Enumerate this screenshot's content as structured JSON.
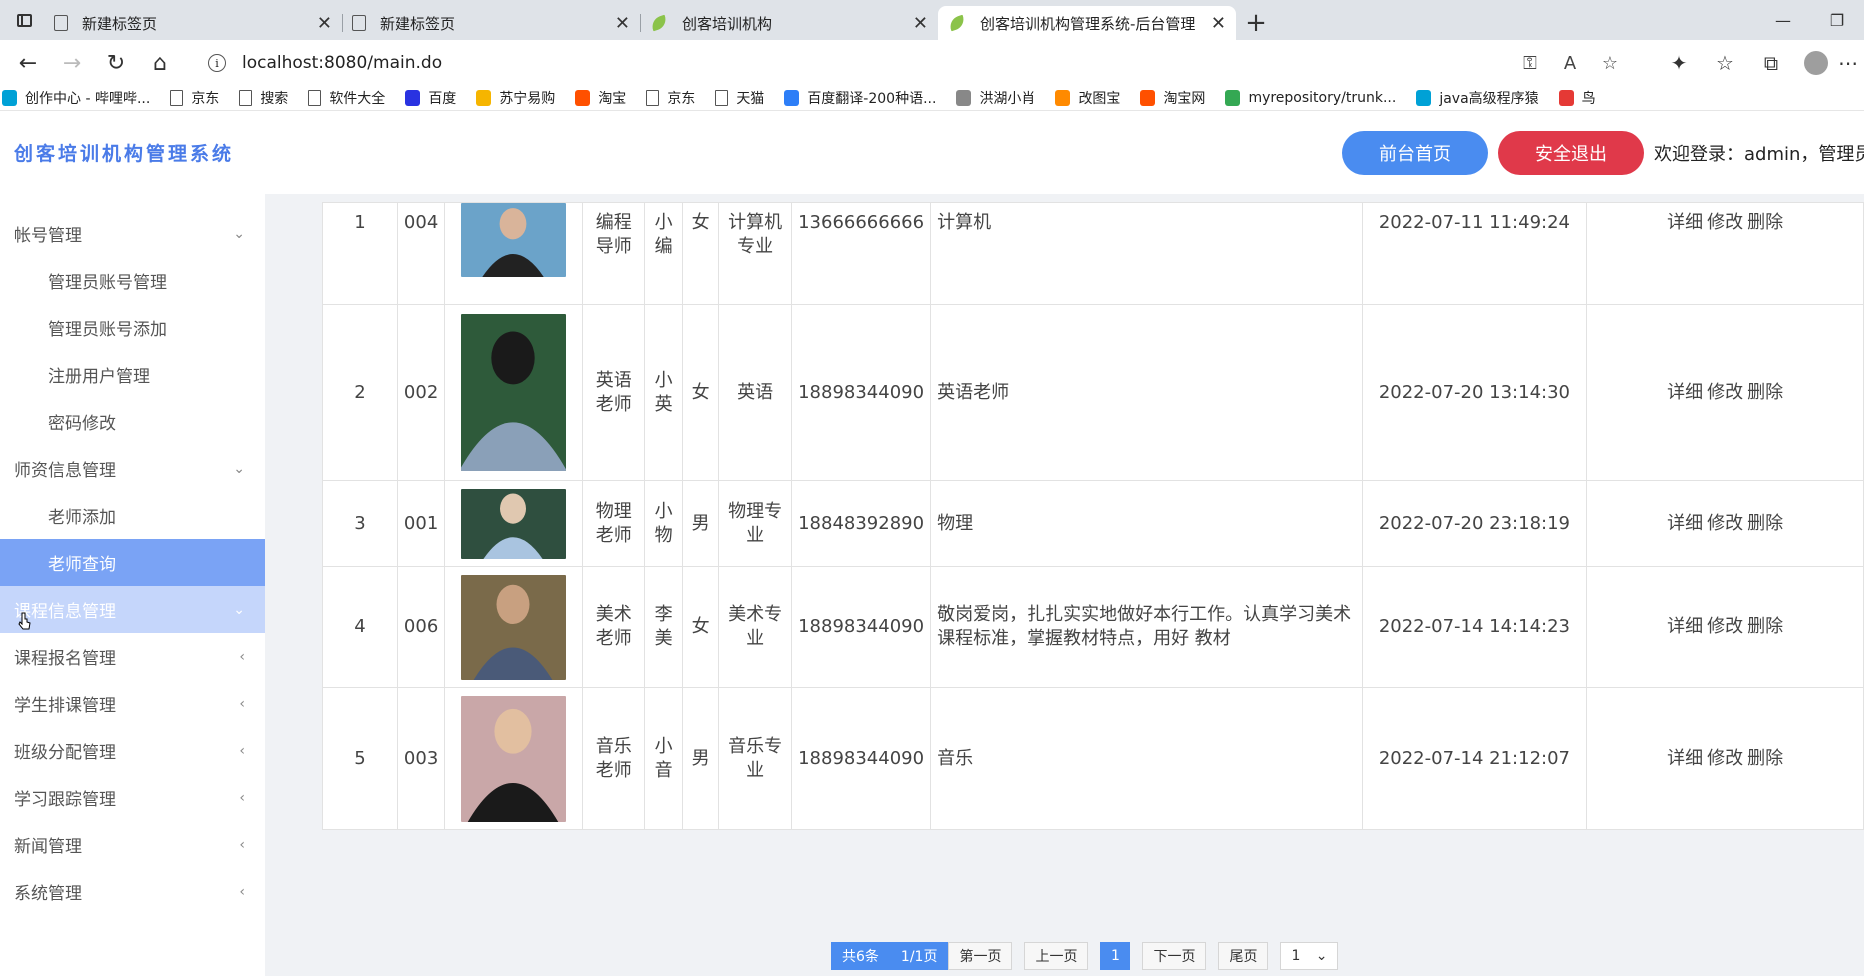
{
  "browser": {
    "tabs": [
      {
        "label": "新建标签页",
        "icon": "page",
        "active": false
      },
      {
        "label": "新建标签页",
        "icon": "page",
        "active": false
      },
      {
        "label": "创客培训机构",
        "icon": "leaf",
        "active": false
      },
      {
        "label": "创客培训机构管理系统-后台管理",
        "icon": "leaf",
        "active": true
      }
    ],
    "url": "localhost:8080/main.do",
    "bookmarks": [
      {
        "label": "创作中心 - 哔哩哔...",
        "color": "#00a1d6"
      },
      {
        "label": "京东",
        "color": "page"
      },
      {
        "label": "搜索",
        "color": "page"
      },
      {
        "label": "软件大全",
        "color": "page"
      },
      {
        "label": "百度",
        "color": "#2932e1"
      },
      {
        "label": "苏宁易购",
        "color": "#f6b500"
      },
      {
        "label": "淘宝",
        "color": "#ff5000"
      },
      {
        "label": "京东",
        "color": "page"
      },
      {
        "label": "天猫",
        "color": "page"
      },
      {
        "label": "百度翻译-200种语...",
        "color": "#2d7ef7"
      },
      {
        "label": "洪湖小肖",
        "color": "#888888"
      },
      {
        "label": "改图宝",
        "color": "#ff8a00"
      },
      {
        "label": "淘宝网",
        "color": "#ff5000"
      },
      {
        "label": "myrepository/trunk...",
        "color": "#34a853"
      },
      {
        "label": "java高级程序猿",
        "color": "#00a1d6"
      },
      {
        "label": "鸟",
        "color": "#e53935"
      }
    ]
  },
  "header": {
    "title": "创客培训机构管理系统",
    "home_btn": "前台首页",
    "logout_btn": "安全退出",
    "welcome": "欢迎登录：admin，管理员"
  },
  "sidebar": {
    "items": [
      {
        "label": "帐号管理",
        "level": 0,
        "chev": "⌄",
        "state": ""
      },
      {
        "label": "管理员账号管理",
        "level": 1,
        "chev": "",
        "state": ""
      },
      {
        "label": "管理员账号添加",
        "level": 1,
        "chev": "",
        "state": ""
      },
      {
        "label": "注册用户管理",
        "level": 1,
        "chev": "",
        "state": ""
      },
      {
        "label": "密码修改",
        "level": 1,
        "chev": "",
        "state": ""
      },
      {
        "label": "师资信息管理",
        "level": 0,
        "chev": "⌄",
        "state": ""
      },
      {
        "label": "老师添加",
        "level": 1,
        "chev": "",
        "state": ""
      },
      {
        "label": "老师查询",
        "level": 1,
        "chev": "",
        "state": "active"
      },
      {
        "label": "课程信息管理",
        "level": 0,
        "chev": "⌄",
        "state": "hover"
      },
      {
        "label": "课程报名管理",
        "level": 0,
        "chev": "‹",
        "state": ""
      },
      {
        "label": "学生排课管理",
        "level": 0,
        "chev": "‹",
        "state": ""
      },
      {
        "label": "班级分配管理",
        "level": 0,
        "chev": "‹",
        "state": ""
      },
      {
        "label": "学习跟踪管理",
        "level": 0,
        "chev": "‹",
        "state": ""
      },
      {
        "label": "新闻管理",
        "level": 0,
        "chev": "‹",
        "state": ""
      },
      {
        "label": "系统管理",
        "level": 0,
        "chev": "‹",
        "state": ""
      }
    ]
  },
  "table": {
    "rows": [
      {
        "no": "1",
        "code": "004",
        "title": "编程导师",
        "name": "小编",
        "gender": "女",
        "major": "计算机专业",
        "phone": "13666666666",
        "intro": "计算机",
        "time": "2022-07-11 11:49:24",
        "photo_colors": [
          "#6ba3c9",
          "#222222",
          "#d9b49a"
        ]
      },
      {
        "no": "2",
        "code": "002",
        "title": "英语老师",
        "name": "小英",
        "gender": "女",
        "major": "英语",
        "phone": "18898344090",
        "intro": "英语老师",
        "time": "2022-07-20 13:14:30",
        "photo_colors": [
          "#2e5a3a",
          "#8aa0b8",
          "#1a1a1a"
        ]
      },
      {
        "no": "3",
        "code": "001",
        "title": "物理老师",
        "name": "小物",
        "gender": "男",
        "major": "物理专业",
        "phone": "18848392890",
        "intro": "物理",
        "time": "2022-07-20 23:18:19",
        "photo_colors": [
          "#2f4f3f",
          "#a9c4e0",
          "#e0c8b0"
        ]
      },
      {
        "no": "4",
        "code": "006",
        "title": "美术老师",
        "name": "李美",
        "gender": "女",
        "major": "美术专业",
        "phone": "18898344090",
        "intro": "敬岗爱岗，扎扎实实地做好本行工作。认真学习美术课程标准，掌握教材特点，用好 教材",
        "time": "2022-07-14 14:14:23",
        "photo_colors": [
          "#7a6a4a",
          "#4a5a78",
          "#c8a080"
        ]
      },
      {
        "no": "5",
        "code": "003",
        "title": "音乐老师",
        "name": "小音",
        "gender": "男",
        "major": "音乐专业",
        "phone": "18898344090",
        "intro": "音乐",
        "time": "2022-07-14 21:12:07",
        "photo_colors": [
          "#c9a7a8",
          "#1a1a1a",
          "#e2bfa0"
        ]
      }
    ],
    "ops": [
      "详细",
      "修改",
      "删除"
    ]
  },
  "pager": {
    "total": "共6条",
    "pages": "1/1页",
    "first": "第一页",
    "prev": "上一页",
    "current": "1",
    "next": "下一页",
    "last": "尾页",
    "select_value": "1"
  }
}
